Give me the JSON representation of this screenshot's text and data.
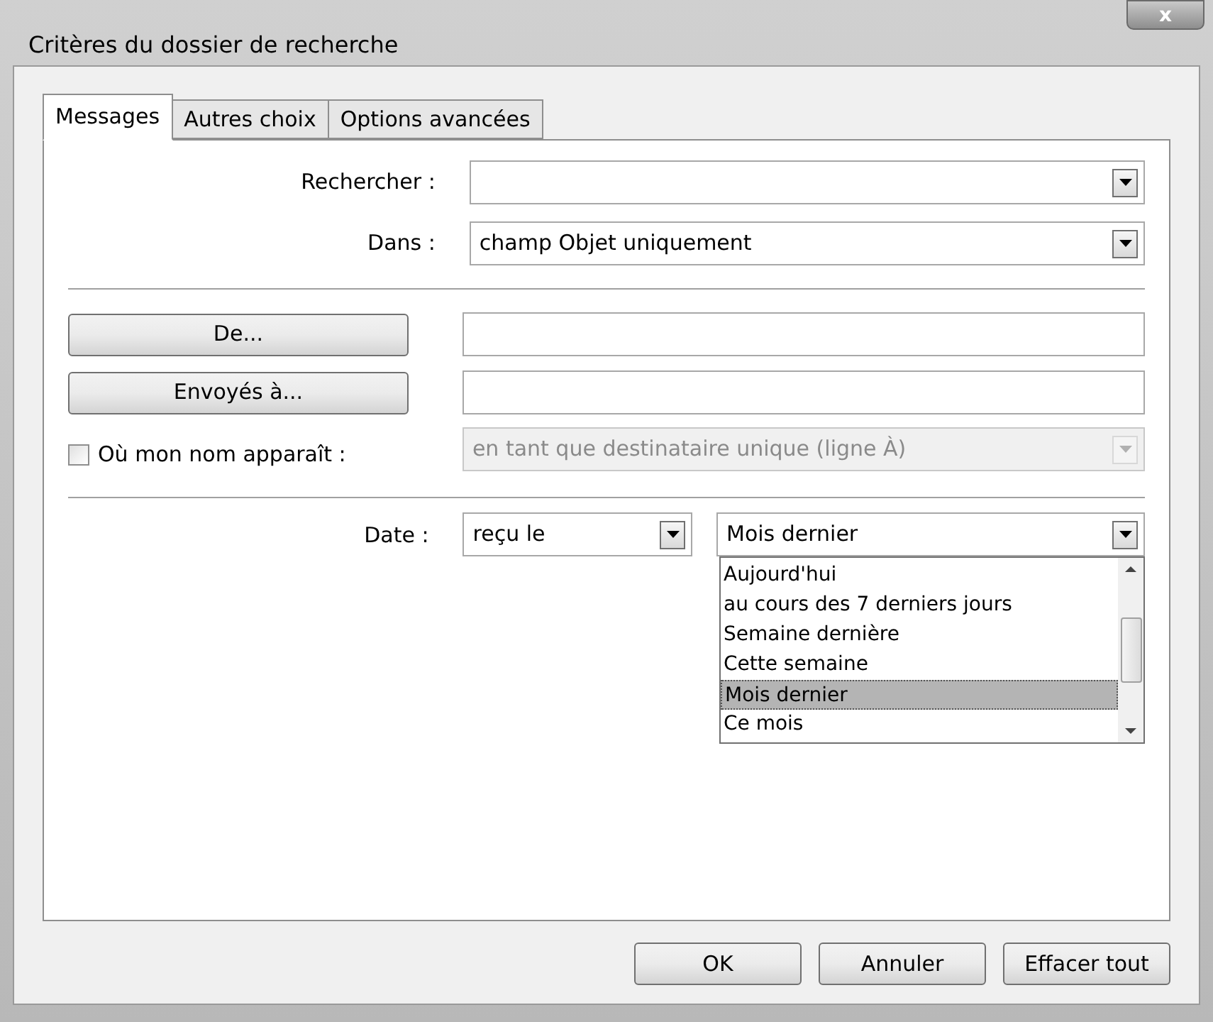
{
  "window": {
    "title": "Critères du dossier de recherche",
    "close": "x"
  },
  "tabs": [
    {
      "label": "Messages",
      "selected": true
    },
    {
      "label": "Autres choix",
      "selected": false
    },
    {
      "label": "Options avancées",
      "selected": false
    }
  ],
  "search": {
    "label": "Rechercher :"
  },
  "in": {
    "label": "Dans :",
    "value": "champ Objet uniquement"
  },
  "from": {
    "button": "De..."
  },
  "sent_to": {
    "button": "Envoyés à..."
  },
  "name_appears": {
    "label": "Où mon nom apparaît :",
    "checked": false,
    "value": "en tant que destinataire unique (ligne À)",
    "disabled": true
  },
  "date": {
    "label": "Date :",
    "type_value": "reçu le",
    "range_value": "Mois dernier",
    "expanded": true,
    "options": [
      {
        "label": "Aujourd'hui",
        "selected": false
      },
      {
        "label": "au cours des 7 derniers jours",
        "selected": false
      },
      {
        "label": "Semaine dernière",
        "selected": false
      },
      {
        "label": "Cette semaine",
        "selected": false
      },
      {
        "label": "Mois dernier",
        "selected": true
      },
      {
        "label": "Ce mois",
        "selected": false
      }
    ]
  },
  "buttons": [
    "OK",
    "Annuler",
    "Effacer tout"
  ]
}
